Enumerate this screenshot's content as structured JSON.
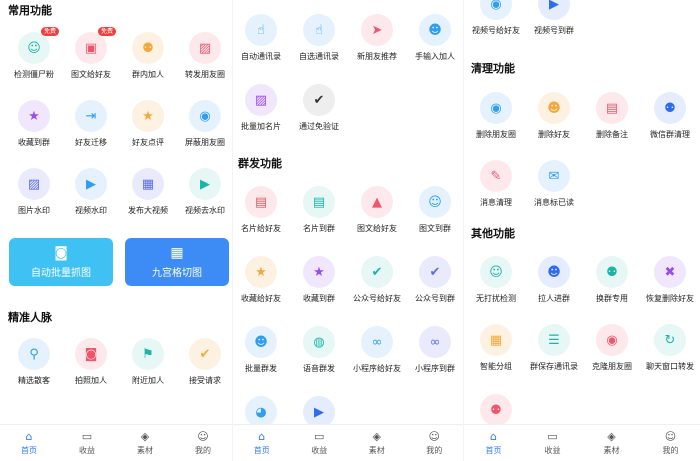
{
  "screen1": {
    "common_title": "常用功能",
    "badge_free": "免费",
    "common": [
      {
        "label": "检测僵尸粉",
        "icon": "detect-zombie-icon",
        "glyph": "☺",
        "color": "#1db4a8",
        "bg": "#e6f7f5"
      },
      {
        "label": "图文给好友",
        "icon": "image-text-friend-icon",
        "glyph": "▣",
        "color": "#f0566a",
        "bg": "#fde9ec"
      },
      {
        "label": "群内加人",
        "icon": "group-add-icon",
        "glyph": "⚉",
        "color": "#f2a93b",
        "bg": "#fdf2e1"
      },
      {
        "label": "转发朋友圈",
        "icon": "forward-moments-icon",
        "glyph": "▨",
        "color": "#f0566a",
        "bg": "#fde9ec"
      },
      {
        "label": "收藏到群",
        "icon": "favorite-group-icon",
        "glyph": "★",
        "color": "#9b4cf0",
        "bg": "#f1e7fd"
      },
      {
        "label": "好友迁移",
        "icon": "friend-migrate-icon",
        "glyph": "⇥",
        "color": "#2d9ef0",
        "bg": "#e5f2fd"
      },
      {
        "label": "好友点评",
        "icon": "friend-review-icon",
        "glyph": "★",
        "color": "#f2a93b",
        "bg": "#fdf2e1"
      },
      {
        "label": "屏蔽朋友圈",
        "icon": "block-moments-icon",
        "glyph": "◉",
        "color": "#2d9ef0",
        "bg": "#e5f2fd"
      },
      {
        "label": "图片水印",
        "icon": "image-watermark-icon",
        "glyph": "▨",
        "color": "#5b6cf0",
        "bg": "#e9ebfd"
      },
      {
        "label": "视频水印",
        "icon": "video-watermark-icon",
        "glyph": "▶",
        "color": "#2d9ef0",
        "bg": "#e5f2fd"
      },
      {
        "label": "发布大视频",
        "icon": "publish-video-icon",
        "glyph": "▦",
        "color": "#5b6cf0",
        "bg": "#e9ebfd"
      },
      {
        "label": "视频去水印",
        "icon": "remove-watermark-icon",
        "glyph": "▶",
        "color": "#1db4a8",
        "bg": "#e6f7f5"
      }
    ],
    "banners": [
      {
        "label": "自动批量抓图",
        "icon": "camera-icon",
        "glyph": "◙",
        "color": "#3fc1f3"
      },
      {
        "label": "九宫格切图",
        "icon": "grid-icon",
        "glyph": "▦",
        "color": "#3d8cf5"
      }
    ],
    "precise_title": "精准人脉",
    "precise": [
      {
        "label": "精选散客",
        "icon": "select-customer-icon",
        "glyph": "⚲",
        "color": "#2d9ef0",
        "bg": "#e5f2fd"
      },
      {
        "label": "拍照加人",
        "icon": "photo-add-icon",
        "glyph": "◙",
        "color": "#f0566a",
        "bg": "#fde9ec"
      },
      {
        "label": "附近加人",
        "icon": "nearby-add-icon",
        "glyph": "⚑",
        "color": "#1db4a8",
        "bg": "#e6f7f5"
      },
      {
        "label": "接受请求",
        "icon": "accept-request-icon",
        "glyph": "✔",
        "color": "#f2a93b",
        "bg": "#fdf2e1"
      }
    ]
  },
  "screen2": {
    "top": [
      {
        "label": "自动通讯录",
        "icon": "auto-contacts-icon",
        "glyph": "☝",
        "color": "#2d9ef0",
        "bg": "#e5f2fd"
      },
      {
        "label": "自选通讯录",
        "icon": "select-contacts-icon",
        "glyph": "☝",
        "color": "#2d9ef0",
        "bg": "#e5f2fd"
      },
      {
        "label": "新朋友推荐",
        "icon": "new-friend-icon",
        "glyph": "➤",
        "color": "#f0566a",
        "bg": "#fde9ec"
      },
      {
        "label": "手输入加人",
        "icon": "manual-add-icon",
        "glyph": "☻",
        "color": "#2d9ef0",
        "bg": "#e5f2fd"
      },
      {
        "label": "批量加名片",
        "icon": "batch-card-icon",
        "glyph": "▨",
        "color": "#9b4cf0",
        "bg": "#f1e7fd"
      },
      {
        "label": "通过免验证",
        "icon": "pass-verify-icon",
        "glyph": "✔",
        "color": "#333",
        "bg": "#eeeeee"
      }
    ],
    "group_title": "群发功能",
    "group": [
      {
        "label": "名片给好友",
        "icon": "card-friend-icon",
        "glyph": "▤",
        "color": "#f0566a",
        "bg": "#fde9ec"
      },
      {
        "label": "名片到群",
        "icon": "card-group-icon",
        "glyph": "▤",
        "color": "#1db4a8",
        "bg": "#e6f7f5"
      },
      {
        "label": "图文给好友",
        "icon": "image-friend-icon",
        "glyph": "▲",
        "color": "#f0566a",
        "bg": "#fde9ec"
      },
      {
        "label": "图文到群",
        "icon": "image-group-icon",
        "glyph": "☺",
        "color": "#2d9ef0",
        "bg": "#e5f2fd"
      },
      {
        "label": "收藏给好友",
        "icon": "fav-friend-icon",
        "glyph": "★",
        "color": "#f2a93b",
        "bg": "#fdf2e1"
      },
      {
        "label": "收藏到群",
        "icon": "fav-group-icon",
        "glyph": "★",
        "color": "#9b4cf0",
        "bg": "#f1e7fd"
      },
      {
        "label": "公众号给好友",
        "icon": "official-friend-icon",
        "glyph": "✔",
        "color": "#1db4a8",
        "bg": "#e6f7f5"
      },
      {
        "label": "公众号到群",
        "icon": "official-group-icon",
        "glyph": "✔",
        "color": "#5b6cf0",
        "bg": "#e9ebfd"
      },
      {
        "label": "批量群发",
        "icon": "batch-send-icon",
        "glyph": "☻",
        "color": "#2d9ef0",
        "bg": "#e5f2fd"
      },
      {
        "label": "语音群发",
        "icon": "voice-send-icon",
        "glyph": "◍",
        "color": "#1db4a8",
        "bg": "#e6f7f5"
      },
      {
        "label": "小程序给好友",
        "icon": "miniapp-friend-icon",
        "glyph": "∞",
        "color": "#2d9ef0",
        "bg": "#e5f2fd"
      },
      {
        "label": "小程序到群",
        "icon": "miniapp-group-icon",
        "glyph": "∞",
        "color": "#5b6cf0",
        "bg": "#e9ebfd"
      }
    ],
    "partial": [
      {
        "icon": "partial-icon-1",
        "glyph": "◕",
        "color": "#2d9ef0",
        "bg": "#e5f2fd"
      },
      {
        "icon": "partial-icon-2",
        "glyph": "▶",
        "color": "#2d6cf0",
        "bg": "#e5ecfd"
      }
    ]
  },
  "screen3": {
    "top": [
      {
        "label": "视频号给好友",
        "icon": "channel-friend-icon",
        "glyph": "◉",
        "color": "#2d9ef0",
        "bg": "#e5f2fd"
      },
      {
        "label": "视频号到群",
        "icon": "channel-group-icon",
        "glyph": "▶",
        "color": "#2d6cf0",
        "bg": "#e5ecfd"
      }
    ],
    "clean_title": "清理功能",
    "clean": [
      {
        "label": "删除朋友圈",
        "icon": "delete-moments-icon",
        "glyph": "◉",
        "color": "#2d9ef0",
        "bg": "#e5f2fd"
      },
      {
        "label": "删除好友",
        "icon": "delete-friend-icon",
        "glyph": "☻",
        "color": "#f2a93b",
        "bg": "#fdf2e1"
      },
      {
        "label": "删除备注",
        "icon": "delete-note-icon",
        "glyph": "▤",
        "color": "#f0566a",
        "bg": "#fde9ec"
      },
      {
        "label": "微信群清理",
        "icon": "group-clean-icon",
        "glyph": "⚉",
        "color": "#2d6cf0",
        "bg": "#e5ecfd"
      },
      {
        "label": "消息清理",
        "icon": "message-clean-icon",
        "glyph": "✎",
        "color": "#f0566a",
        "bg": "#fde9ec"
      },
      {
        "label": "消息标已读",
        "icon": "message-read-icon",
        "glyph": "✉",
        "color": "#2d9ef0",
        "bg": "#e5f2fd"
      }
    ],
    "other_title": "其他功能",
    "other": [
      {
        "label": "无打扰检测",
        "icon": "no-disturb-icon",
        "glyph": "☺",
        "color": "#1db4a8",
        "bg": "#e6f7f5"
      },
      {
        "label": "拉人进群",
        "icon": "pull-group-icon",
        "glyph": "☻",
        "color": "#2d6cf0",
        "bg": "#e5ecfd"
      },
      {
        "label": "换群专用",
        "icon": "switch-group-icon",
        "glyph": "⚉",
        "color": "#1db4a8",
        "bg": "#e6f7f5"
      },
      {
        "label": "恢复删除好友",
        "icon": "restore-friend-icon",
        "glyph": "✖",
        "color": "#9b4cf0",
        "bg": "#f1e7fd"
      },
      {
        "label": "智能分组",
        "icon": "smart-group-icon",
        "glyph": "▦",
        "color": "#f2a93b",
        "bg": "#fdf2e1"
      },
      {
        "label": "群保存通讯录",
        "icon": "save-contacts-icon",
        "glyph": "☰",
        "color": "#1db4a8",
        "bg": "#e6f7f5"
      },
      {
        "label": "克隆朋友圈",
        "icon": "clone-moments-icon",
        "glyph": "◉",
        "color": "#f0566a",
        "bg": "#fde9ec"
      },
      {
        "label": "聊天窗口转发",
        "icon": "chat-forward-icon",
        "glyph": "↻",
        "color": "#1db4a8",
        "bg": "#e6f7f5"
      }
    ],
    "partial": [
      {
        "icon": "partial-icon-3",
        "glyph": "⚉",
        "color": "#f0566a",
        "bg": "#fde9ec"
      }
    ]
  },
  "tabs": [
    {
      "label": "首页",
      "icon": "home-icon",
      "glyph": "⌂",
      "active": true
    },
    {
      "label": "收益",
      "icon": "wallet-icon",
      "glyph": "▭",
      "active": false
    },
    {
      "label": "素材",
      "icon": "layers-icon",
      "glyph": "◈",
      "active": false
    },
    {
      "label": "我的",
      "icon": "profile-icon",
      "glyph": "☺",
      "active": false
    }
  ]
}
